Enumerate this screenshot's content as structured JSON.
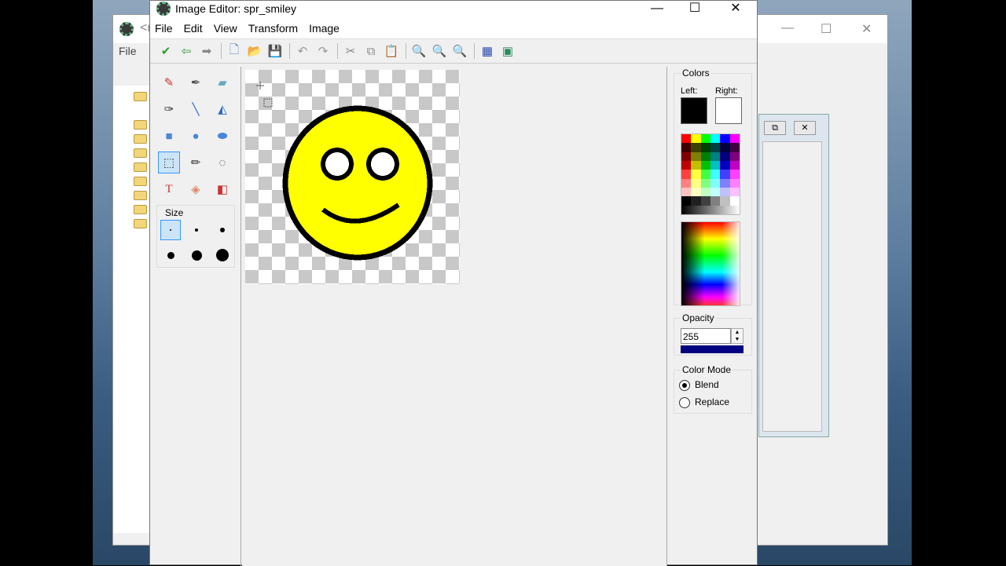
{
  "back_window": {
    "title": "<r",
    "menu_first": "File"
  },
  "window": {
    "title": "Image Editor: spr_smiley",
    "minimize": "—",
    "maximize": "☐",
    "close": "✕"
  },
  "menu": [
    "File",
    "Edit",
    "View",
    "Transform",
    "Image"
  ],
  "toolbar": [
    {
      "name": "confirm-icon",
      "glyph": "✔",
      "color": "#2aa02a"
    },
    {
      "name": "undo-arrow-back-icon",
      "glyph": "⇦",
      "color": "#3a9a3a"
    },
    {
      "name": "forward-arrow-icon",
      "glyph": "➡",
      "color": "#888"
    },
    {
      "sep": true
    },
    {
      "name": "new-icon",
      "glyph": "🗋",
      "color": "#4a7fc1"
    },
    {
      "name": "open-folder-icon",
      "glyph": "📂",
      "color": "#d8a32c"
    },
    {
      "name": "save-icon",
      "glyph": "💾",
      "color": "#5050b0"
    },
    {
      "sep": true
    },
    {
      "name": "undo-icon",
      "glyph": "↶",
      "color": "#999"
    },
    {
      "name": "redo-icon",
      "glyph": "↷",
      "color": "#999"
    },
    {
      "sep": true
    },
    {
      "name": "cut-icon",
      "glyph": "✂",
      "color": "#888"
    },
    {
      "name": "copy-icon",
      "glyph": "⧉",
      "color": "#888"
    },
    {
      "name": "paste-icon",
      "glyph": "📋",
      "color": "#c9a44a"
    },
    {
      "sep": true
    },
    {
      "name": "zoom-out-icon",
      "glyph": "🔍",
      "color": "#4a7fc1"
    },
    {
      "name": "zoom-reset-icon",
      "glyph": "🔍",
      "color": "#4a7fc1"
    },
    {
      "name": "zoom-in-icon",
      "glyph": "🔍",
      "color": "#4a7fc1"
    },
    {
      "sep": true
    },
    {
      "name": "grid-icon",
      "glyph": "▦",
      "color": "#2a4ab0"
    },
    {
      "name": "image-icon",
      "glyph": "▣",
      "color": "#2a8a5a"
    }
  ],
  "tools": [
    {
      "name": "pencil-icon",
      "glyph": "✎",
      "color": "#c33"
    },
    {
      "name": "spray-icon",
      "glyph": "✒",
      "color": "#555"
    },
    {
      "name": "eraser-icon",
      "glyph": "▰",
      "color": "#6ab"
    },
    {
      "name": "color-picker-icon",
      "glyph": "✑",
      "color": "#333"
    },
    {
      "name": "line-icon",
      "glyph": "╲",
      "color": "#2a6ac8"
    },
    {
      "name": "polygon-icon",
      "glyph": "◭",
      "color": "#2a6ac8"
    },
    {
      "name": "rectangle-icon",
      "glyph": "■",
      "color": "#4a86d8"
    },
    {
      "name": "ellipse-icon",
      "glyph": "●",
      "color": "#4a86d8"
    },
    {
      "name": "rounded-rectangle-icon",
      "glyph": "⬬",
      "color": "#4a86d8"
    },
    {
      "name": "select-rectangle-icon",
      "glyph": "⬚",
      "color": "#333",
      "selected": true
    },
    {
      "name": "magic-wand-icon",
      "glyph": "✏",
      "color": "#333"
    },
    {
      "name": "select-ellipse-icon",
      "glyph": "◌",
      "color": "#333"
    },
    {
      "name": "text-icon",
      "glyph": "T",
      "color": "#c33"
    },
    {
      "name": "fill-icon",
      "glyph": "◈",
      "color": "#d86"
    },
    {
      "name": "replace-color-icon",
      "glyph": "◧",
      "color": "#c33"
    }
  ],
  "size": {
    "label": "Size",
    "dots": [
      2,
      4,
      6,
      9,
      13,
      16
    ],
    "selected_index": 0
  },
  "colors": {
    "label": "Colors",
    "left_label": "Left:",
    "right_label": "Right:",
    "left_color": "#000000",
    "right_color": "#ffffff",
    "palette": [
      "#ff0000",
      "#ffff00",
      "#00ff00",
      "#00ffff",
      "#0000ff",
      "#ff00ff",
      "#400000",
      "#404000",
      "#004000",
      "#004040",
      "#000040",
      "#400040",
      "#800000",
      "#808000",
      "#008000",
      "#008080",
      "#000080",
      "#800080",
      "#c00000",
      "#c0c000",
      "#00c000",
      "#00c0c0",
      "#0000c0",
      "#c000c0",
      "#ff4040",
      "#ffff40",
      "#40ff40",
      "#40ffff",
      "#4040ff",
      "#ff40ff",
      "#ff8080",
      "#ffff80",
      "#80ff80",
      "#80ffff",
      "#8080ff",
      "#ff80ff",
      "#ffc0c0",
      "#ffffc0",
      "#c0ffc0",
      "#c0ffff",
      "#c0c0ff",
      "#ffc0ff",
      "#000000",
      "#202020",
      "#404040",
      "#808080",
      "#c0c0c0",
      "#ffffff"
    ]
  },
  "opacity": {
    "label": "Opacity",
    "value": "255",
    "fill_fraction": 1.0,
    "bar_color": "#000080"
  },
  "color_mode": {
    "label": "Color Mode",
    "options": [
      "Blend",
      "Replace"
    ],
    "selected": "Blend"
  },
  "sprite": {
    "face_color": "#ffff00",
    "outline_color": "#000000"
  }
}
